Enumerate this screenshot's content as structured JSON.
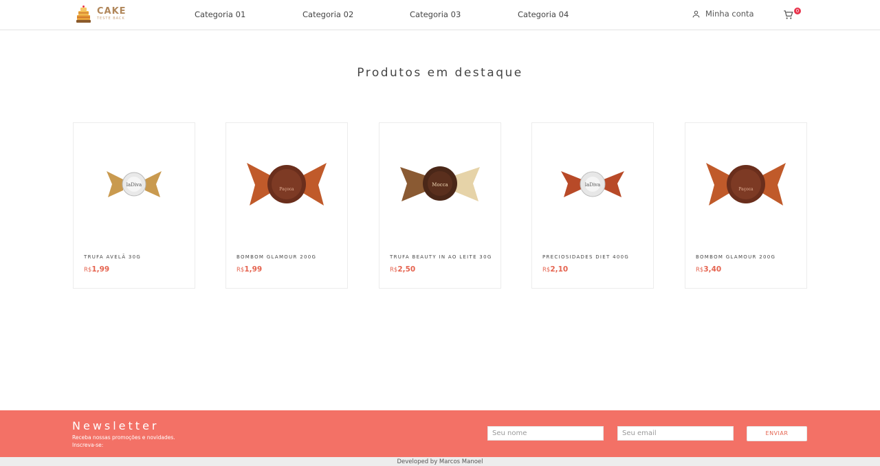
{
  "brand": {
    "title": "CAKE",
    "subtitle": "TESTE BACK"
  },
  "nav": {
    "categories": [
      "Categoria 01",
      "Categoria 02",
      "Categoria 03",
      "Categoria 04"
    ],
    "account_label": "Minha conta",
    "cart_count": "0"
  },
  "section": {
    "title": "Produtos em destaque"
  },
  "products": [
    {
      "name": "TRUFA AVELÃ 30G",
      "currency": "R$",
      "price": "1,99",
      "image": "truffle-silver-wrapper"
    },
    {
      "name": "BOMBOM GLAMOUR 200G",
      "currency": "R$",
      "price": "1,99",
      "image": "bonbon-copper-wrapper"
    },
    {
      "name": "TRUFA BEAUTY IN AO LEITE 30G",
      "currency": "R$",
      "price": "2,50",
      "image": "truffle-gold-wrapper"
    },
    {
      "name": "PRECIOSIDADES DIET 400G",
      "currency": "R$",
      "price": "2,10",
      "image": "truffle-silver-copper-wrapper"
    },
    {
      "name": "BOMBOM GLAMOUR 200G",
      "currency": "R$",
      "price": "3,40",
      "image": "bonbon-copper-wrapper"
    }
  ],
  "newsletter": {
    "title": "Newsletter",
    "line1": "Receba nossas promoções e novidades.",
    "line2": "Inscreva-se:",
    "name_placeholder": "Seu nome",
    "email_placeholder": "Seu email",
    "submit_label": "ENVIAR"
  },
  "footer": {
    "credit": "Developed by Marcos Manoel"
  },
  "colors": {
    "accent": "#f37166",
    "price": "#e5634f",
    "badge": "#e8324b"
  }
}
